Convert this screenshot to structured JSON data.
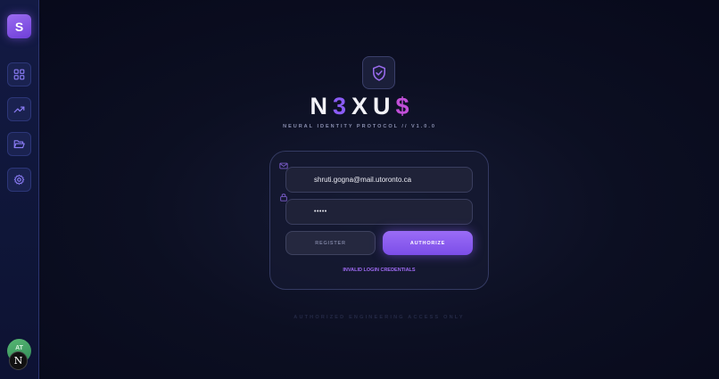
{
  "sidebar": {
    "logo_letter": "S",
    "items": [
      {
        "icon": "dashboard-grid-icon"
      },
      {
        "icon": "trending-up-icon"
      },
      {
        "icon": "folder-open-icon"
      },
      {
        "icon": "gear-icon"
      }
    ],
    "avatar_initials": "AT",
    "n_badge": "N"
  },
  "brand": {
    "parts": [
      "N",
      "3",
      "XU",
      "$"
    ],
    "subtitle": "NEURAL IDENTITY PROTOCOL // V1.0.0",
    "accent_color": "#8b5cf6",
    "dollar_color": "#c14fd8"
  },
  "login": {
    "email_value": "shruti.gogna@mail.utoronto.ca",
    "password_mask": "•••••",
    "register_label": "REGISTER",
    "authorize_label": "AUTHORIZE",
    "error_message": "INVALID LOGIN CREDENTIALS"
  },
  "footer": {
    "text": "AUTHORIZED ENGINEERING ACCESS ONLY"
  }
}
